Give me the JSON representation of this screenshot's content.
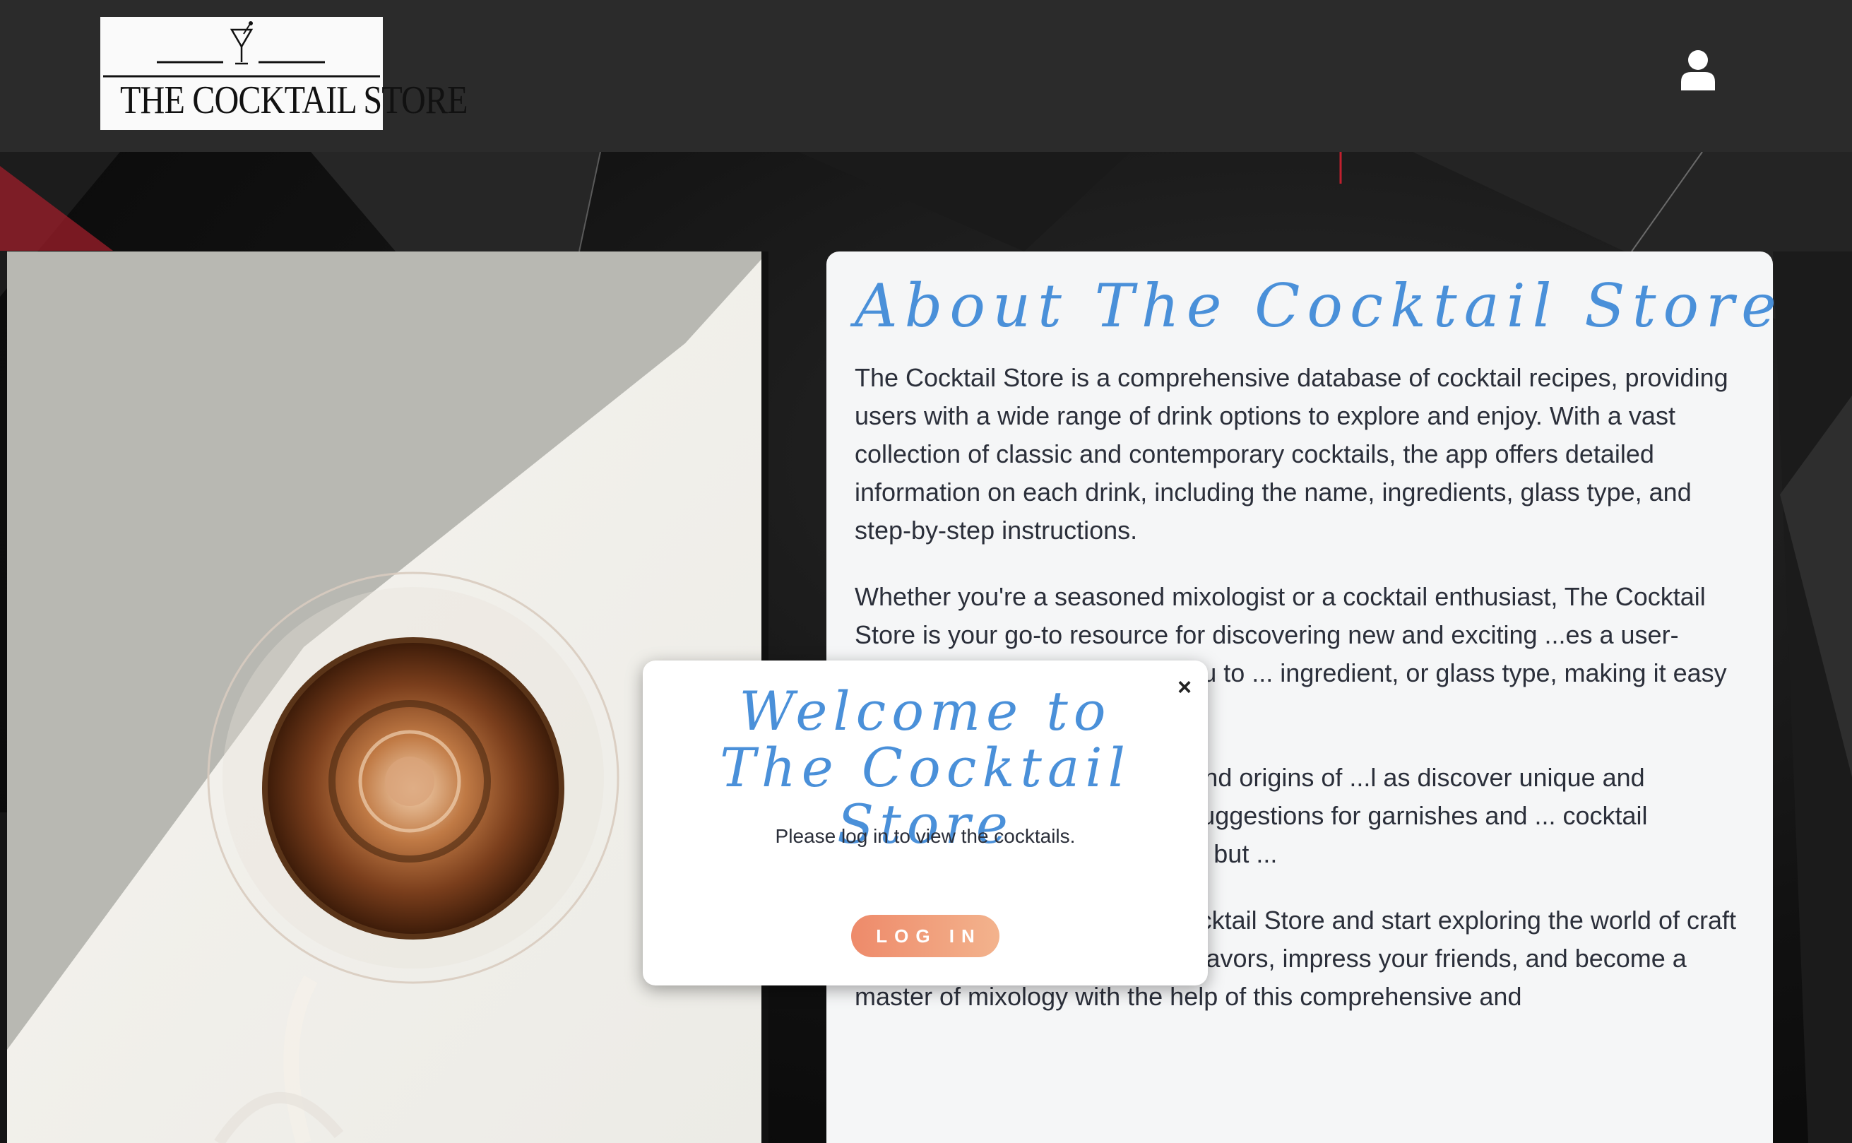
{
  "header": {
    "logo_text": "THE COCKTAIL STORE",
    "user_icon": "user-icon"
  },
  "about": {
    "title": "About The Cocktail Store",
    "paragraphs": [
      "The Cocktail Store is a comprehensive database of cocktail recipes, providing users with a wide range of drink options to explore and enjoy. With a vast collection of classic and contemporary cocktails, the app offers detailed information on each drink, including the name, ingredients, glass type, and step-by-step instructions.",
      "Whether you're a seasoned mixologist or a cocktail enthusiast, The Cocktail Store is your go-to resource for discovering new and exciting ...es a user-friendly interface that allows you to ... ingredient, or glass type, making it easy to ... occasion.",
      "... can learn about the history and origins of ...l as discover unique and creative twists on ... provides suggestions for garnishes and ... cocktail experience is not only delicious but ...",
      "So why wait? Log in to The Cocktail Store and start exploring the world of craft cocktails today. Discover new flavors, impress your friends, and become a master of mixology with the help of this comprehensive and"
    ]
  },
  "modal": {
    "title": "Welcome to The Cocktail Store",
    "text": "Please log in to view the cocktails.",
    "close_label": "×",
    "login_label": "LOG IN"
  },
  "colors": {
    "header_bg": "#2b2b2b",
    "accent_title": "#4a90d9",
    "button_gradient_start": "#ee8a6a",
    "button_gradient_end": "#f3b38d",
    "card_bg": "#f5f6f7"
  }
}
